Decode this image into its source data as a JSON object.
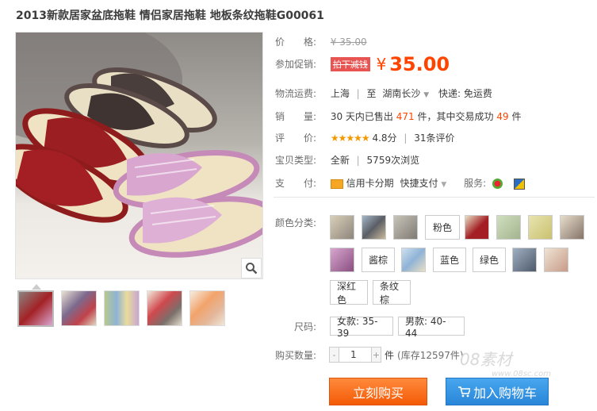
{
  "product": {
    "title": "2013新款居家盆底拖鞋 情侣家居拖鞋 地板条纹拖鞋G00061"
  },
  "price": {
    "label": "价　　格:",
    "value": "¥ 35.00"
  },
  "promo": {
    "label": "参加促销:",
    "tag": "拍下减钱",
    "currency": "¥",
    "value": "35.00"
  },
  "shipping": {
    "label": "物流运费:",
    "from": "上海",
    "to_label": "至",
    "to": "湖南长沙",
    "express": "快递: 免运费"
  },
  "sales": {
    "label": "销　　量:",
    "prefix": "30 天内已售出",
    "count": "471",
    "mid": "件，其中交易成功",
    "success": "49",
    "suffix": "件"
  },
  "rating": {
    "label": "评　　价:",
    "stars": "★★★★★",
    "score": "4.8分",
    "count_text": "31条评价"
  },
  "type": {
    "label": "宝贝类型:",
    "value": "全新",
    "views": "5759次浏览"
  },
  "payment": {
    "label": "支　　付:",
    "credit": "信用卡分期",
    "quick": "快捷支付",
    "service_label": "服务:"
  },
  "color": {
    "label": "颜色分类:",
    "options": [
      "",
      "",
      "",
      "粉色",
      "",
      "",
      "",
      "",
      "",
      "酱棕",
      "",
      "蓝色",
      "绿色",
      "",
      "",
      "深红色",
      "条纹棕"
    ]
  },
  "size": {
    "label": "尺码:",
    "options": [
      "女款: 35-39",
      "男款: 40-44"
    ]
  },
  "quantity": {
    "label": "购买数量:",
    "value": "1",
    "unit": "件",
    "stock": "(库存12597件)"
  },
  "buttons": {
    "buy": "立刻购买",
    "cart": "加入购物车"
  },
  "watermark": {
    "main": "08素材",
    "sub": "www.08sc.com"
  }
}
